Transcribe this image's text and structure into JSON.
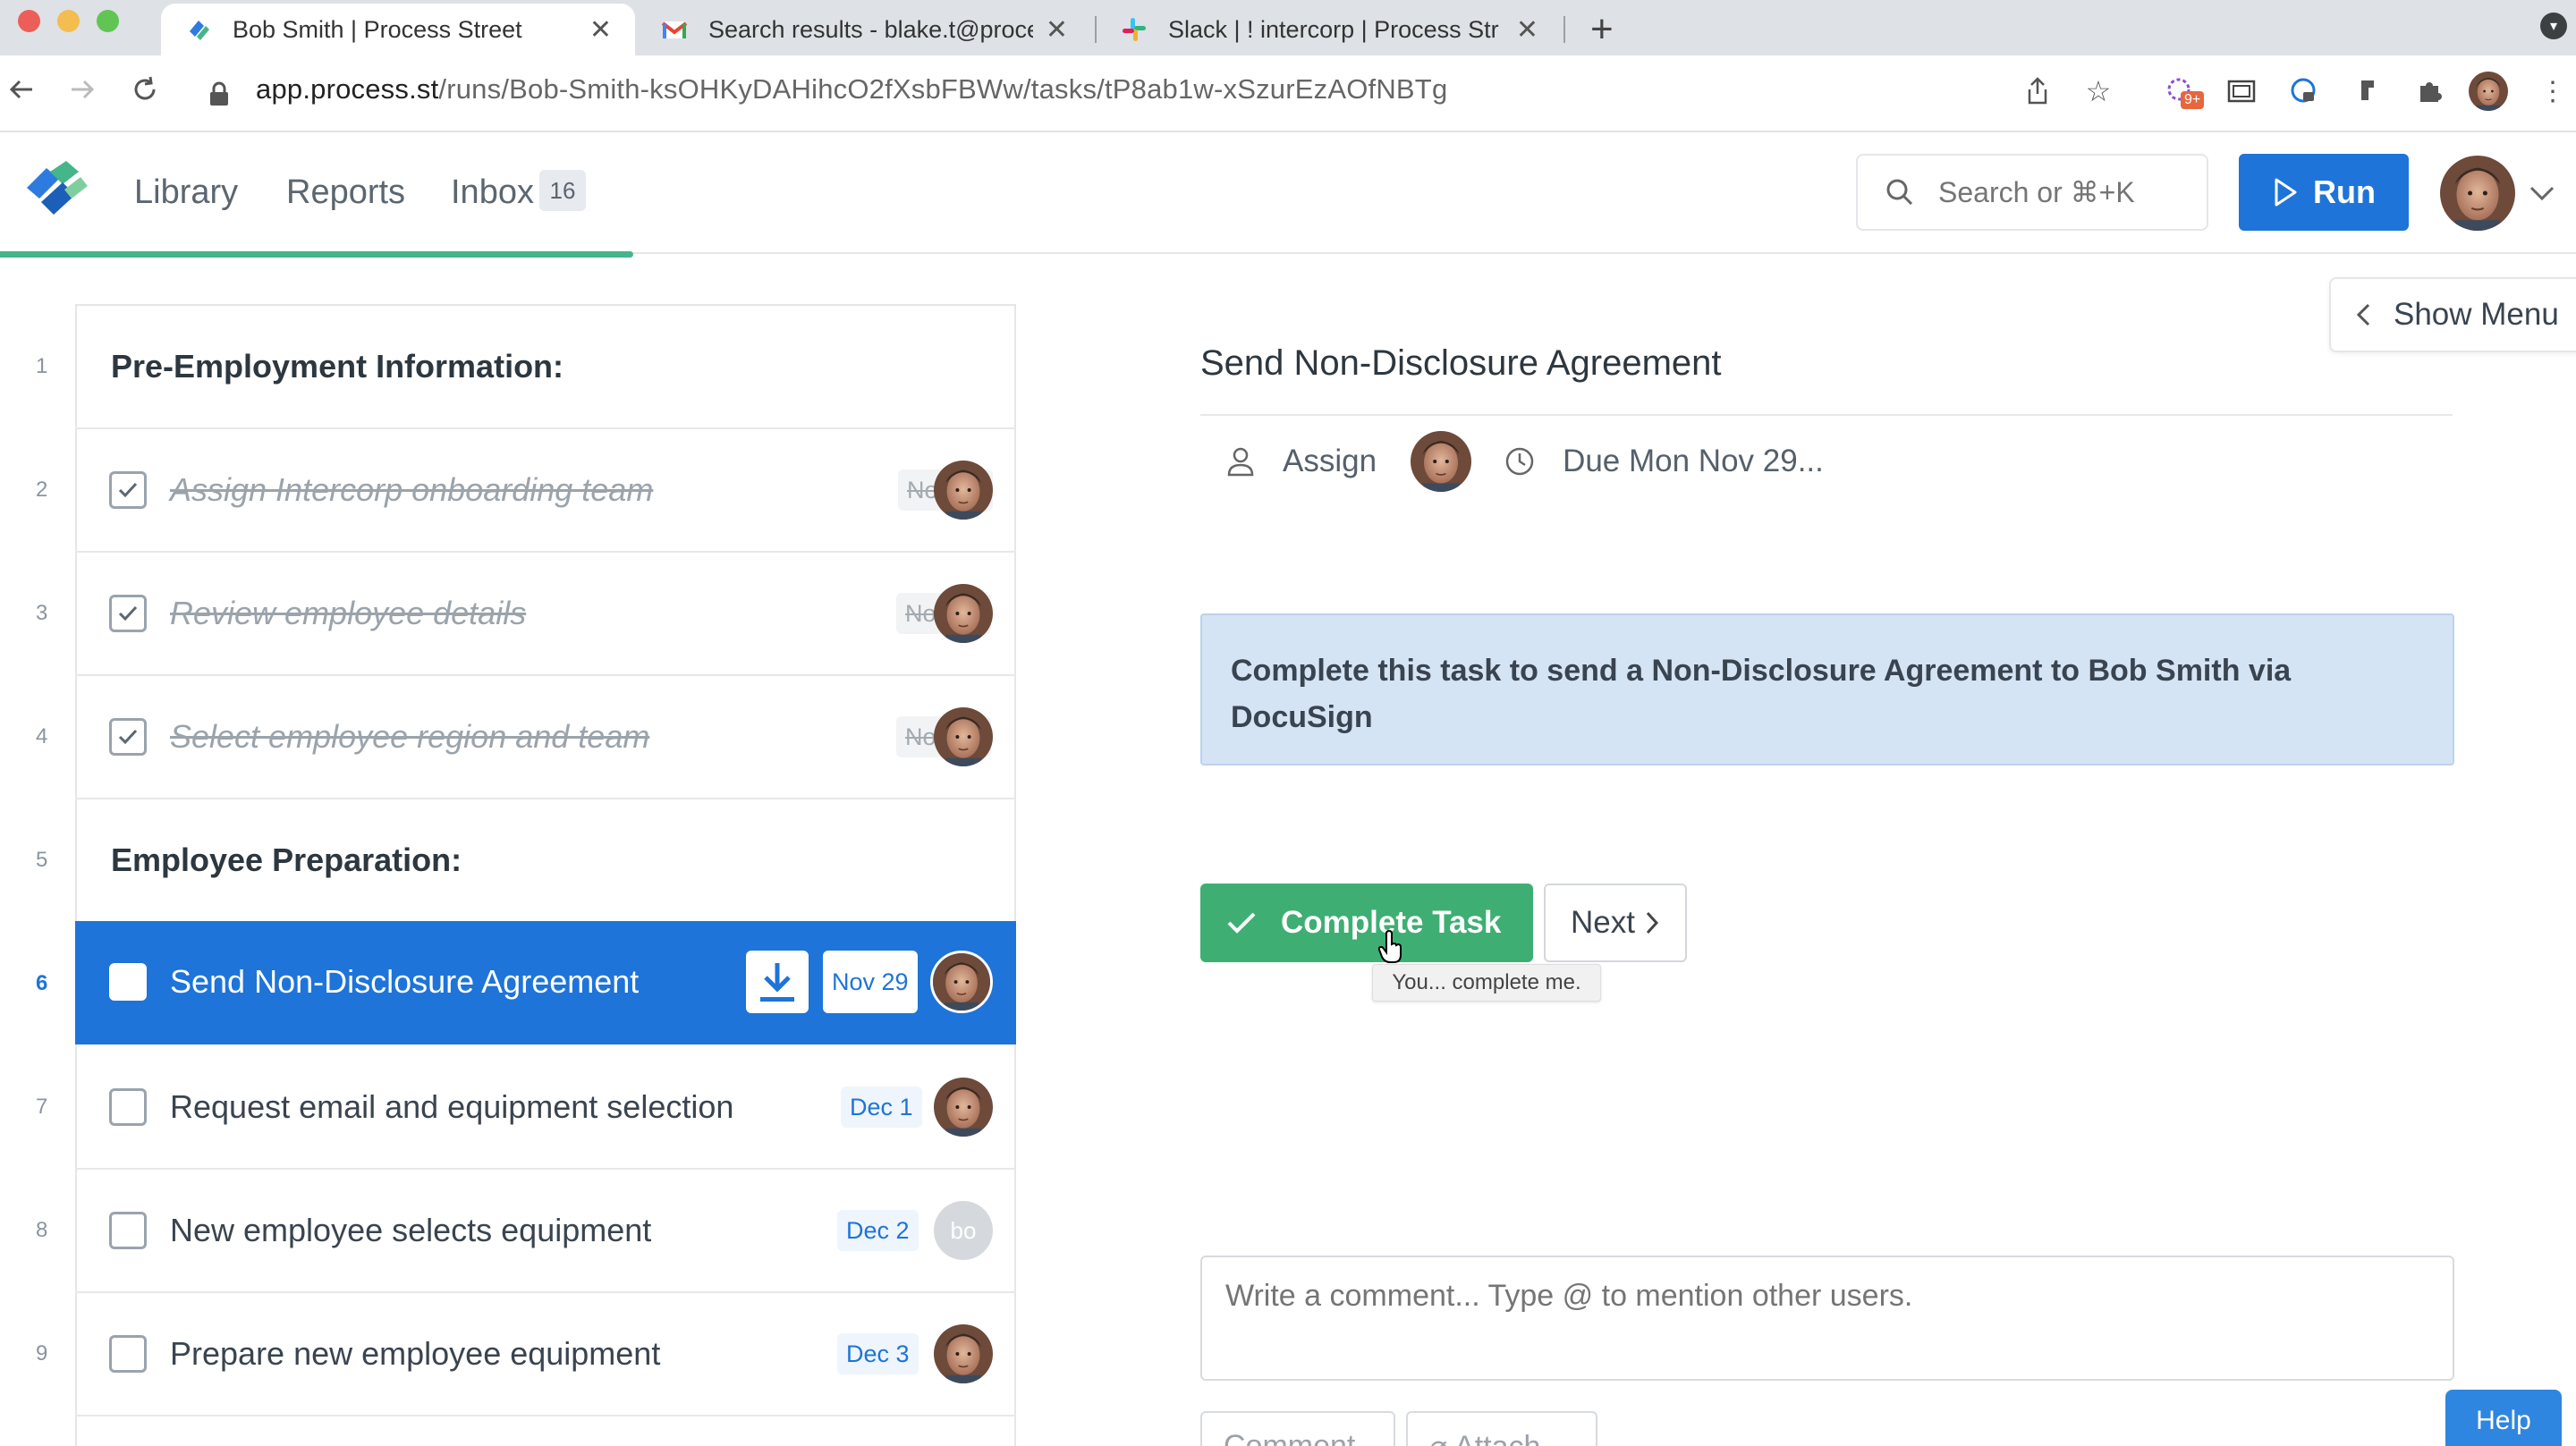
{
  "browser": {
    "tabs": [
      {
        "title": "Bob Smith | Process Street",
        "icon": "process-street-icon"
      },
      {
        "title": "Search results - blake.t@proce",
        "icon": "gmail-icon"
      },
      {
        "title": "Slack | ! intercorp | Process Str",
        "icon": "slack-icon"
      }
    ],
    "url_host": "app.process.st",
    "url_path": "/runs/Bob-Smith-ksOHKyDAHihcO2fXsbFBWw/tasks/tP8ab1w-xSzurEzAOfNBTg",
    "extension_badge": "9+"
  },
  "app": {
    "nav": {
      "library": "Library",
      "reports": "Reports",
      "inbox": "Inbox",
      "inbox_count": "16"
    },
    "search_placeholder": "Search or ⌘+K",
    "run_label": "Run",
    "accent_color": "#1e74d8",
    "success_color": "#3fae73"
  },
  "tasks": {
    "row1": {
      "num": "1",
      "label": "Pre-Employment Information:"
    },
    "row2": {
      "num": "2",
      "label": "Assign Intercorp onboarding team",
      "date": "Nov 19"
    },
    "row3": {
      "num": "3",
      "label": "Review employee details",
      "date": "Nov 20"
    },
    "row4": {
      "num": "4",
      "label": "Select employee region and team",
      "date": "Nov 20"
    },
    "row5": {
      "num": "5",
      "label": "Employee Preparation:"
    },
    "row6": {
      "num": "6",
      "label": "Send Non-Disclosure Agreement",
      "date": "Nov 29"
    },
    "row7": {
      "num": "7",
      "label": "Request email and equipment selection",
      "date": "Dec 1"
    },
    "row8": {
      "num": "8",
      "label": "New employee selects equipment",
      "date": "Dec 2",
      "initials": "bo"
    },
    "row9": {
      "num": "9",
      "label": "Prepare new employee equipment",
      "date": "Dec 3"
    }
  },
  "detail": {
    "show_menu": "Show Menu",
    "title": "Send Non-Disclosure Agreement",
    "assign_label": "Assign",
    "due_label": "Due Mon Nov 29...",
    "callout": "Complete this task to send a Non-Disclosure Agreement to Bob Smith via DocuSign",
    "complete_label": "Complete Task",
    "next_label": "Next",
    "tooltip": "You... complete me.",
    "comment_placeholder": "Write a comment... Type @ to mention other users.",
    "comment_btn": "Comment",
    "attach_btn": "Attach",
    "help_label": "Help"
  }
}
